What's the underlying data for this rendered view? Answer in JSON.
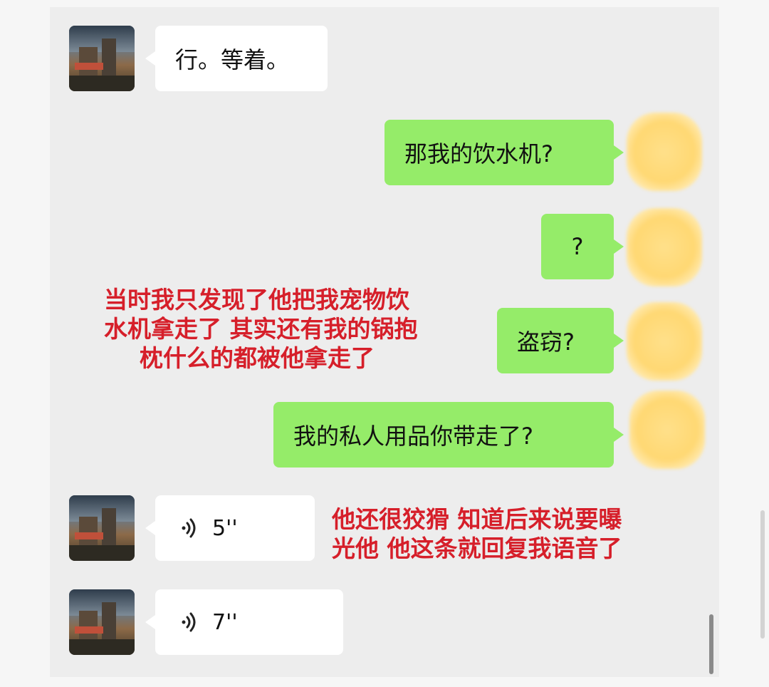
{
  "messages": [
    {
      "side": "left",
      "type": "text",
      "text": "行。等着。"
    },
    {
      "side": "right",
      "type": "text",
      "text": "那我的饮水机?"
    },
    {
      "side": "right",
      "type": "text",
      "text": "?"
    },
    {
      "side": "right",
      "type": "text",
      "text": "盗窃?"
    },
    {
      "side": "right",
      "type": "text",
      "text": "我的私人用品你带走了?"
    },
    {
      "side": "left",
      "type": "voice",
      "duration": "5''",
      "icon": "voice-wave-icon"
    },
    {
      "side": "left",
      "type": "voice",
      "duration": "7''",
      "icon": "voice-wave-icon"
    }
  ],
  "annotations": {
    "first": [
      "当时我只发现了他把我宠物饮",
      "水机拿走了 其实还有我的锅抱",
      "枕什么的都被他拿走了"
    ],
    "second": [
      "他还很狡猾 知道后来说要曝",
      "光他 他这条就回复我语音了"
    ]
  },
  "colors": {
    "self_bubble": "#95ec69",
    "other_bubble": "#ffffff",
    "chat_background": "#ededed",
    "annotation_text": "#d61f2a",
    "blurred_avatar": "#ffd873"
  }
}
